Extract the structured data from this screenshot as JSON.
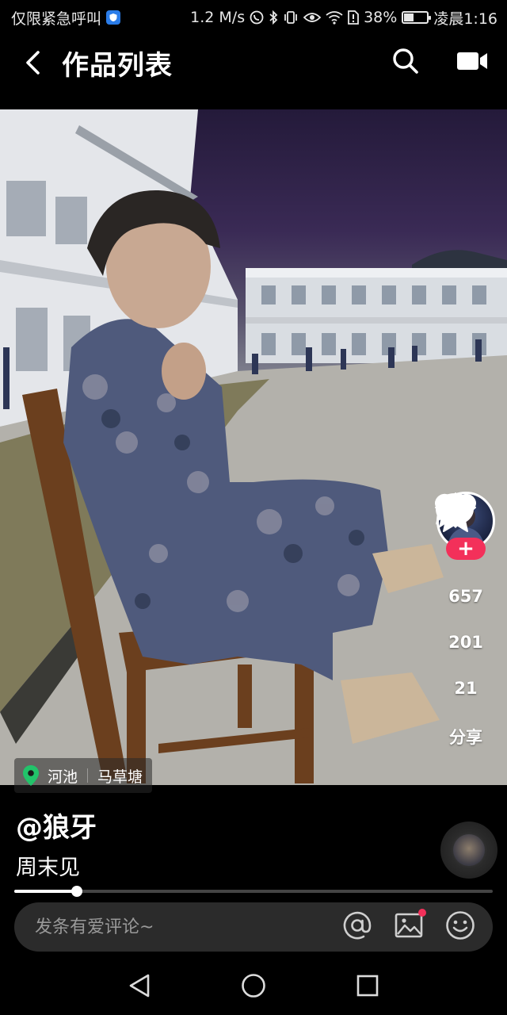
{
  "status_bar": {
    "carrier_text": "仅限紧急呼叫",
    "net_speed": "1.2 M/s",
    "battery": "38%",
    "battery_fraction": 0.38,
    "time": "凌晨1:16"
  },
  "header": {
    "title": "作品列表"
  },
  "rail": {
    "likes": "657",
    "comments": "201",
    "favorites": "21",
    "share_label": "分享",
    "follow_symbol": "+"
  },
  "location": {
    "city": "河池",
    "place": "马草塘"
  },
  "post": {
    "author": "@狼牙",
    "caption": "周末见"
  },
  "playback": {
    "progress_fraction": 0.13
  },
  "comment": {
    "placeholder": "发条有爱评论~"
  },
  "colors": {
    "accent": "#f3305a",
    "location_pin": "#22c36a",
    "background": "#000000"
  },
  "icons": [
    "back-icon",
    "search-icon",
    "video-camera-icon",
    "heart-icon",
    "comment-icon",
    "star-icon",
    "share-icon",
    "location-pin-icon",
    "at-icon",
    "image-icon",
    "emoji-icon",
    "nav-back-icon",
    "nav-home-icon",
    "nav-recents-icon"
  ]
}
